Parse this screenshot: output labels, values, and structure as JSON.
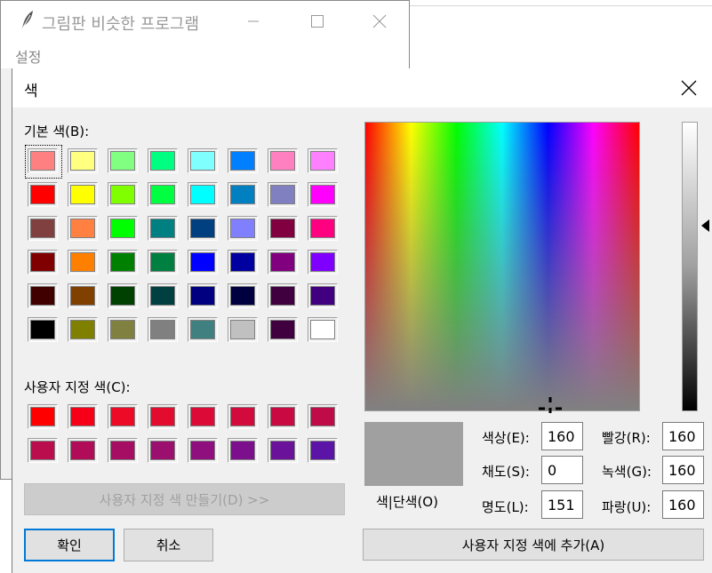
{
  "bg_window": {
    "title": "그림판 비슷한 프로그램",
    "menu": "설정"
  },
  "dialog": {
    "title": "색",
    "basic_colors_label": "기본 색(B):",
    "custom_colors_label": "사용자 지정 색(C):",
    "define_custom_button": "사용자 지정 색 만들기(D) >>",
    "ok_button": "확인",
    "cancel_button": "취소",
    "add_custom_button": "사용자 지정 색에 추가(A)",
    "color_solid_label": "색|단색(O)",
    "fields": {
      "hue": {
        "label": "색상(E):",
        "value": "160"
      },
      "sat": {
        "label": "채도(S):",
        "value": "0"
      },
      "lum": {
        "label": "명도(L):",
        "value": "151"
      },
      "red": {
        "label": "빨강(R):",
        "value": "160"
      },
      "green": {
        "label": "녹색(G):",
        "value": "160"
      },
      "blue": {
        "label": "파랑(U):",
        "value": "160"
      }
    },
    "preview_color": "#a0a0a0",
    "basic_colors": [
      [
        "#ff8080",
        "#ffff80",
        "#80ff80",
        "#00ff80",
        "#80ffff",
        "#0080ff",
        "#ff80c0",
        "#ff80ff"
      ],
      [
        "#ff0000",
        "#ffff00",
        "#80ff00",
        "#00ff40",
        "#00ffff",
        "#0080c0",
        "#8080c0",
        "#ff00ff"
      ],
      [
        "#804040",
        "#ff8040",
        "#00ff00",
        "#008080",
        "#004080",
        "#8080ff",
        "#800040",
        "#ff0080"
      ],
      [
        "#800000",
        "#ff8000",
        "#008000",
        "#008040",
        "#0000ff",
        "#0000a0",
        "#800080",
        "#8000ff"
      ],
      [
        "#400000",
        "#804000",
        "#004000",
        "#004040",
        "#000080",
        "#000040",
        "#400040",
        "#400080"
      ],
      [
        "#000000",
        "#808000",
        "#808040",
        "#808080",
        "#408080",
        "#c0c0c0",
        "#400040",
        "#ffffff"
      ]
    ],
    "custom_colors": [
      [
        "#ff0000",
        "#f60018",
        "#ec0a26",
        "#e30c2f",
        "#dc0a36",
        "#d30a3c",
        "#c90a42",
        "#bf0b48"
      ],
      [
        "#ba0d4e",
        "#b00c58",
        "#a50e63",
        "#9b0f6e",
        "#8e0f7d",
        "#7c108c",
        "#6b129a",
        "#5b14a6"
      ]
    ]
  }
}
